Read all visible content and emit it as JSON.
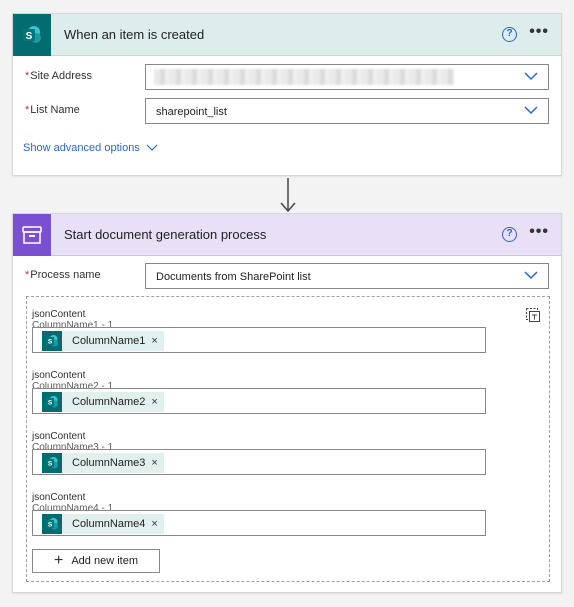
{
  "trigger": {
    "title": "When an item is created",
    "help_glyph": "?",
    "more_glyph": "•••",
    "icon": "sharepoint-icon",
    "icon_letter": "S",
    "fields": [
      {
        "label": "Site Address",
        "required": true,
        "value": ""
      },
      {
        "label": "List Name",
        "required": true,
        "value": "sharepoint_list"
      }
    ],
    "advanced_link": "Show advanced options"
  },
  "action": {
    "title": "Start document generation process",
    "help_glyph": "?",
    "more_glyph": "•••",
    "icon": "document-generation-icon",
    "process_label": "Process name",
    "process_required": true,
    "process_value": "Documents from SharePoint list",
    "items": [
      {
        "label": "jsonContent",
        "sublabel": "ColumnName1 - 1",
        "token": "ColumnName1"
      },
      {
        "label": "jsonContent",
        "sublabel": "ColumnName2 - 1",
        "token": "ColumnName2"
      },
      {
        "label": "jsonContent",
        "sublabel": "ColumnName3 - 1",
        "token": "ColumnName3"
      },
      {
        "label": "jsonContent",
        "sublabel": "ColumnName4 - 1",
        "token": "ColumnName4"
      }
    ],
    "token_remove_glyph": "×",
    "add_item_label": "Add new item",
    "add_item_glyph": "+"
  },
  "colors": {
    "sharepoint": "#036c70",
    "doc_icon": "#7a4fd0",
    "link": "#2c66cc",
    "required": "#c4314b"
  }
}
